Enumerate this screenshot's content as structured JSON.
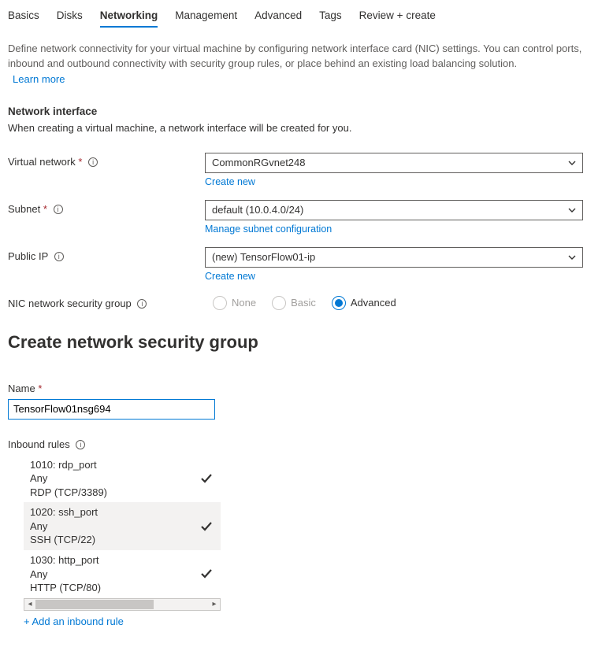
{
  "tabs": {
    "t0": "Basics",
    "t1": "Disks",
    "t2": "Networking",
    "t3": "Management",
    "t4": "Advanced",
    "t5": "Tags",
    "t6": "Review + create"
  },
  "desc": {
    "text": "Define network connectivity for your virtual machine by configuring network interface card (NIC) settings. You can control ports, inbound and outbound connectivity with security group rules, or place behind an existing load balancing solution.",
    "learn_more": "Learn more"
  },
  "network_interface": {
    "title": "Network interface",
    "note": "When creating a virtual machine, a network interface will be created for you."
  },
  "fields": {
    "vnet_label": "Virtual network",
    "vnet_value": "CommonRGvnet248",
    "vnet_link": "Create new",
    "subnet_label": "Subnet",
    "subnet_value": "default (10.0.4.0/24)",
    "subnet_link": "Manage subnet configuration",
    "pip_label": "Public IP",
    "pip_value": "(new) TensorFlow01-ip",
    "pip_link": "Create new",
    "nsg_label": "NIC network security group",
    "nsg_opts": {
      "none": "None",
      "basic": "Basic",
      "advanced": "Advanced"
    }
  },
  "nsg_create": {
    "heading": "Create network security group",
    "name_label": "Name",
    "name_value": "TensorFlow01nsg694"
  },
  "inbound": {
    "title": "Inbound rules",
    "rules": {
      "r0": {
        "line1": "1010: rdp_port",
        "line2": "Any",
        "line3": "RDP (TCP/3389)"
      },
      "r1": {
        "line1": "1020: ssh_port",
        "line2": "Any",
        "line3": "SSH (TCP/22)"
      },
      "r2": {
        "line1": "1030: http_port",
        "line2": "Any",
        "line3": "HTTP (TCP/80)"
      }
    },
    "add_link": "+ Add an inbound rule"
  }
}
